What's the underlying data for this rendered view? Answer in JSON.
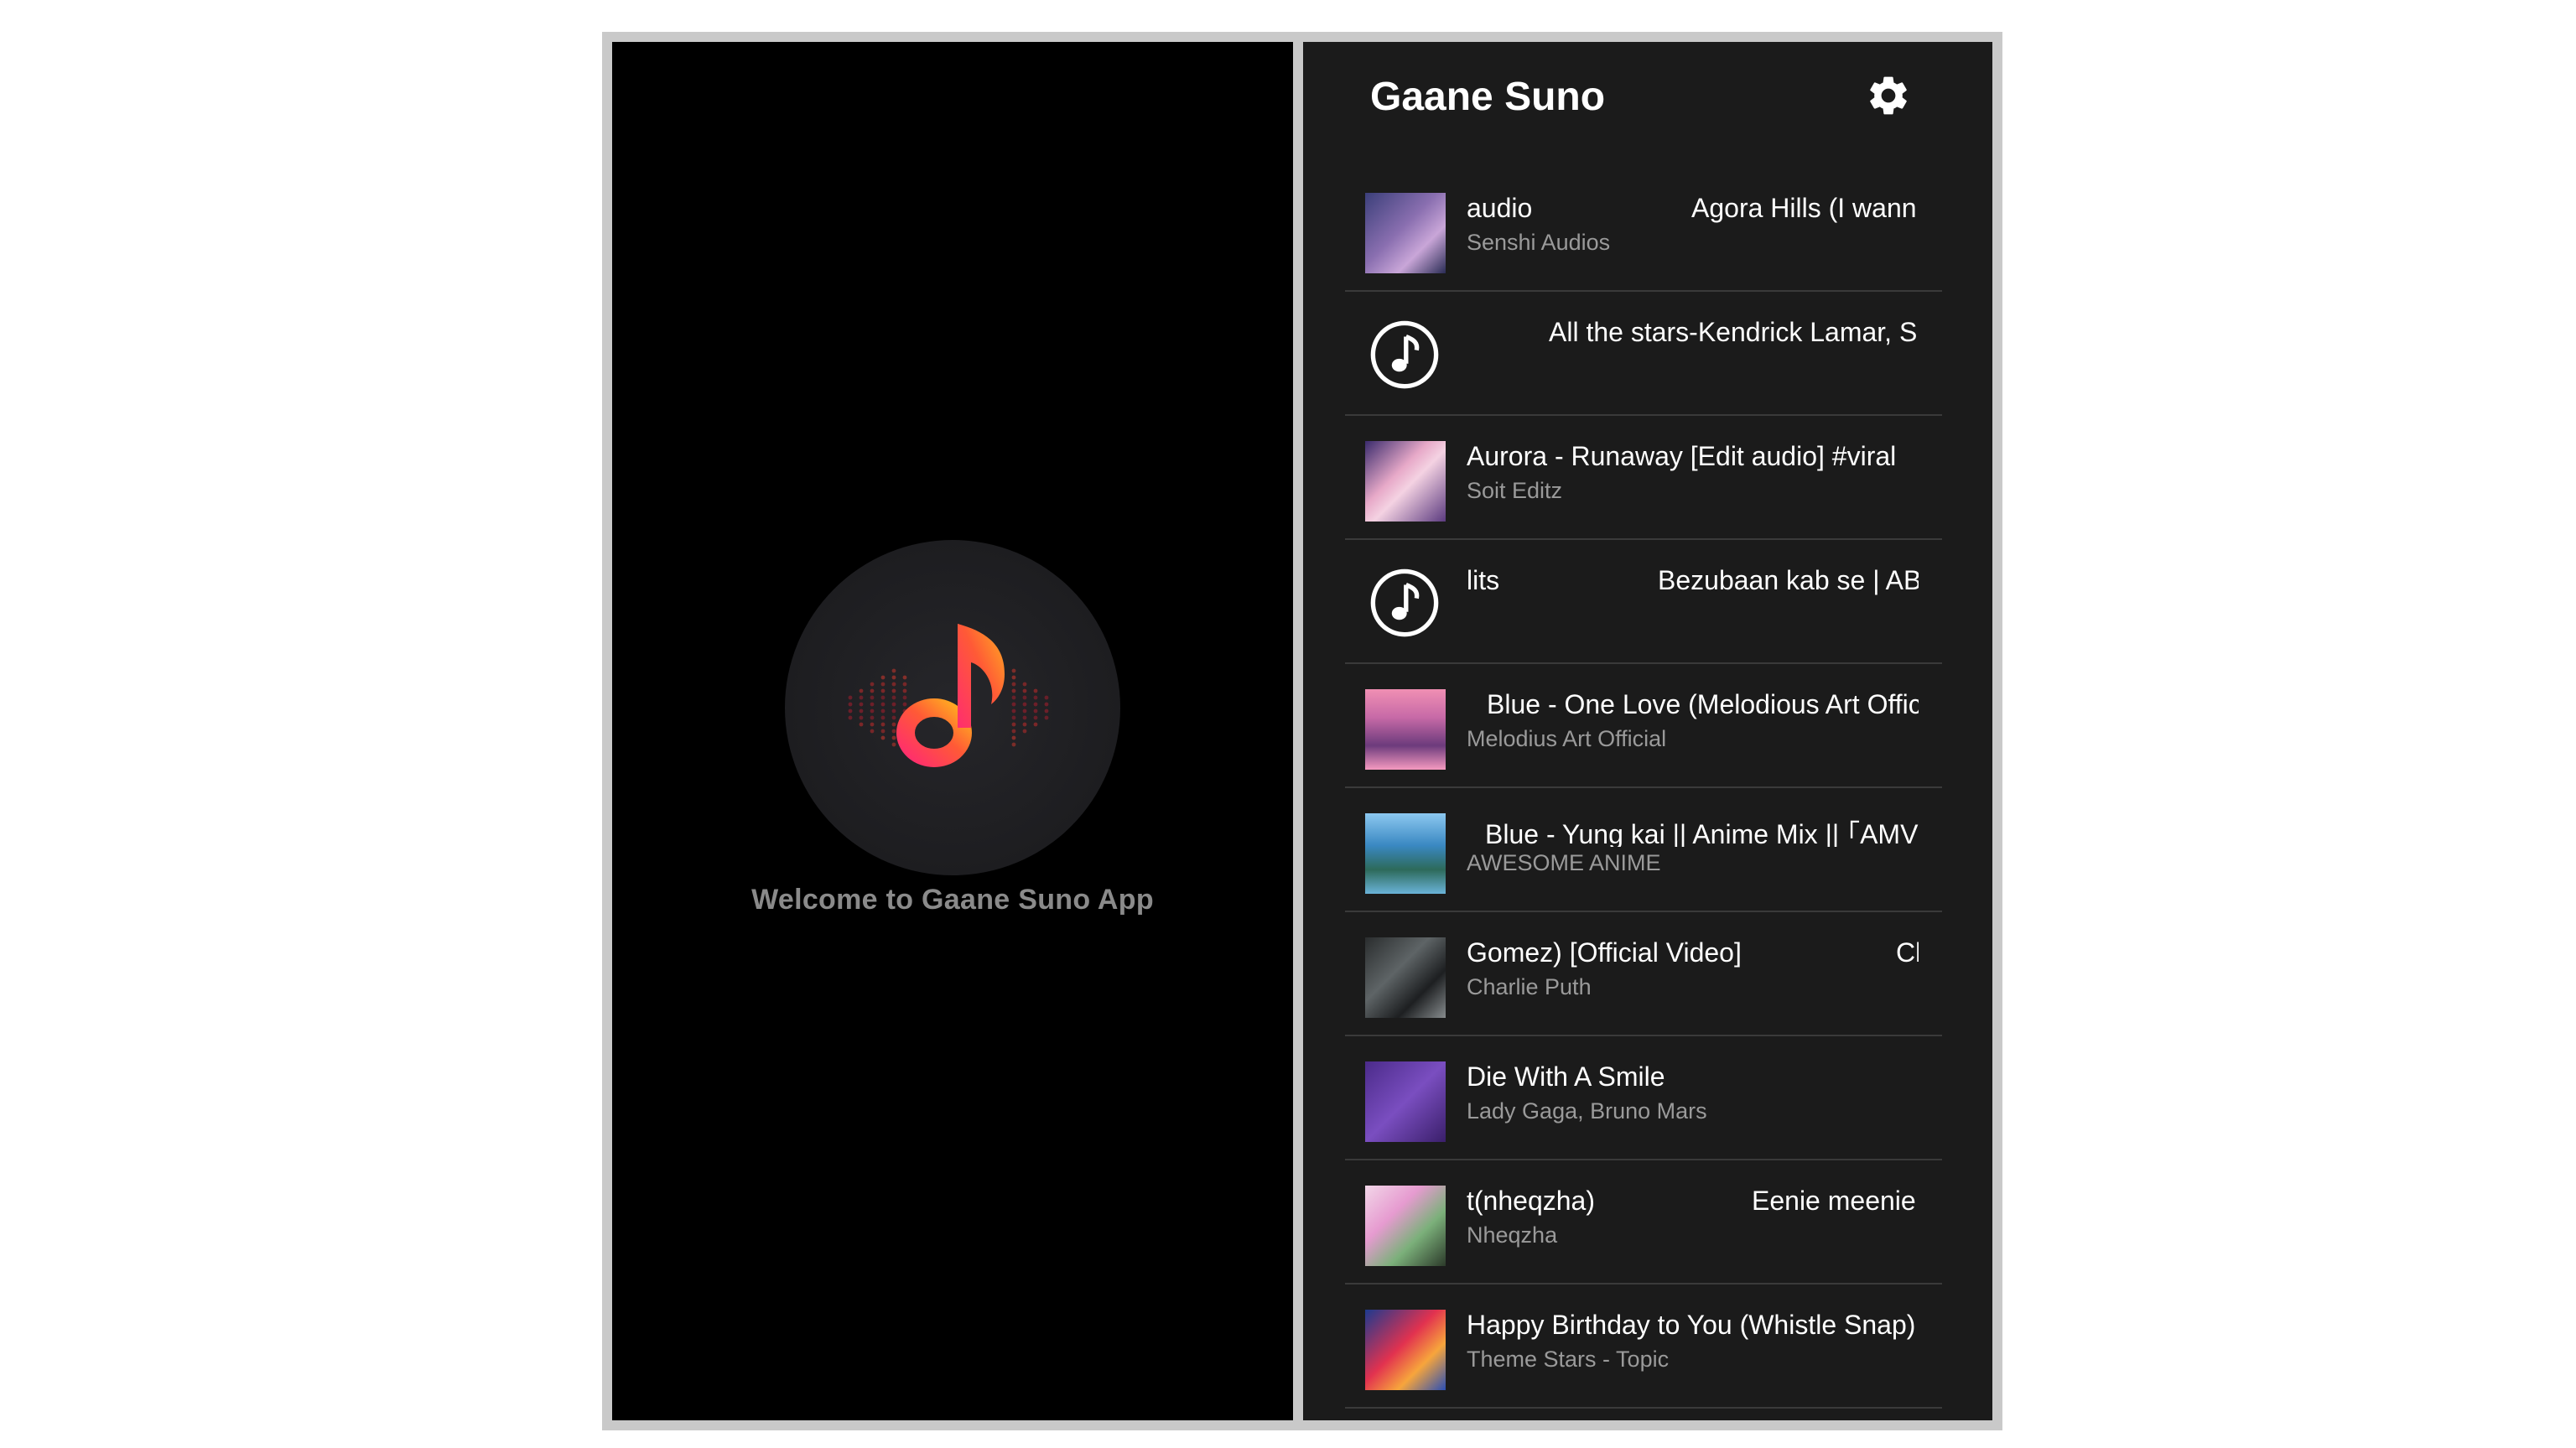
{
  "splash": {
    "welcome_text": "Welcome to Gaane Suno App",
    "logo_icon": "music-note-icon"
  },
  "app": {
    "title": "Gaane Suno",
    "settings_icon": "gear-icon",
    "songs": [
      {
        "title_fragments": [
          "audio",
          "Agora Hills (I wann"
        ],
        "artist": "Senshi Audios",
        "thumb": "image"
      },
      {
        "title_fragments": [
          "All the stars-Kendrick Lamar, S"
        ],
        "artist": "",
        "thumb": "music-note-icon"
      },
      {
        "title_fragments": [
          "Aurora - Runaway [Edit audio] #viral"
        ],
        "artist": "Soit Editz",
        "thumb": "image"
      },
      {
        "title_fragments": [
          "lits",
          "Bezubaan kab se | AB"
        ],
        "artist": "",
        "thumb": "music-note-icon"
      },
      {
        "title_fragments": [
          "Blue - One Love (Melodious Art Offic"
        ],
        "artist": "Melodius Art Official",
        "thumb": "image"
      },
      {
        "title_fragments": [
          "Blue - Yung kai || Anime Mix || ｢AMV｣"
        ],
        "artist": "AWESOME ANIME",
        "thumb": "image"
      },
      {
        "title_fragments": [
          "Gomez) [Official Video]",
          "Cl"
        ],
        "artist": "Charlie Puth",
        "thumb": "image"
      },
      {
        "title_fragments": [
          "Die With A Smile"
        ],
        "artist": "Lady Gaga, Bruno Mars",
        "thumb": "image"
      },
      {
        "title_fragments": [
          "t(nheqzha)",
          "Eenie meenie"
        ],
        "artist": "Nheqzha",
        "thumb": "image"
      },
      {
        "title_fragments": [
          "Happy Birthday to You (Whistle Snap)"
        ],
        "artist": "Theme Stars - Topic",
        "thumb": "image"
      }
    ]
  }
}
